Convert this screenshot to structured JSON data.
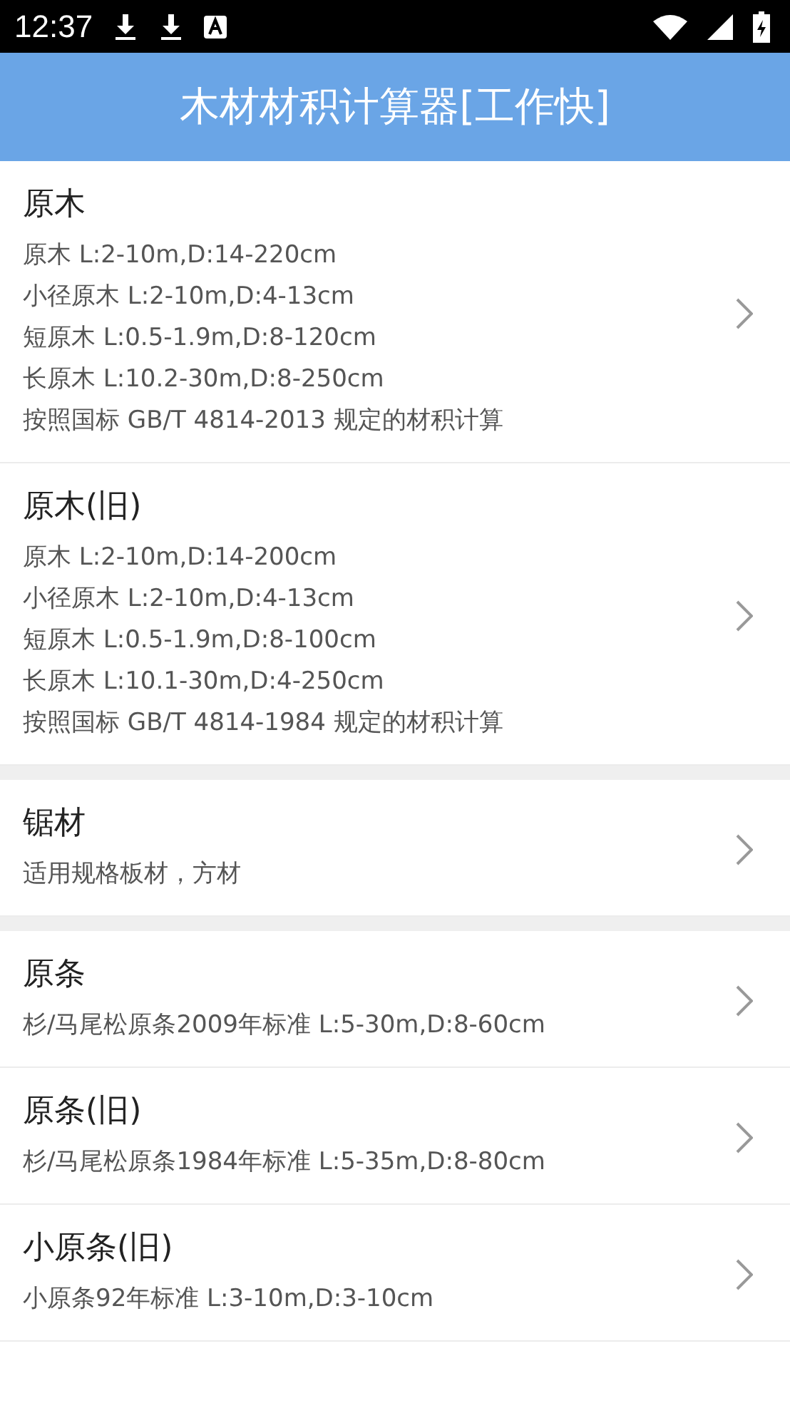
{
  "status_bar": {
    "time": "12:37"
  },
  "app_bar": {
    "title": "木材材积计算器[工作快]"
  },
  "sections": [
    {
      "items": [
        {
          "title": "原木",
          "lines": [
            "原木 L:2-10m,D:14-220cm",
            "小径原木 L:2-10m,D:4-13cm",
            "短原木 L:0.5-1.9m,D:8-120cm",
            "长原木 L:10.2-30m,D:8-250cm",
            "按照国标 GB/T 4814-2013 规定的材积计算"
          ]
        },
        {
          "title": "原木(旧)",
          "lines": [
            "原木 L:2-10m,D:14-200cm",
            "小径原木 L:2-10m,D:4-13cm",
            "短原木 L:0.5-1.9m,D:8-100cm",
            "长原木 L:10.1-30m,D:4-250cm",
            "按照国标 GB/T 4814-1984 规定的材积计算"
          ]
        }
      ]
    },
    {
      "items": [
        {
          "title": "锯材",
          "lines": [
            "适用规格板材，方材"
          ]
        }
      ]
    },
    {
      "items": [
        {
          "title": "原条",
          "lines": [
            "杉/马尾松原条2009年标准 L:5-30m,D:8-60cm"
          ]
        },
        {
          "title": "原条(旧)",
          "lines": [
            "杉/马尾松原条1984年标准 L:5-35m,D:8-80cm"
          ]
        },
        {
          "title": "小原条(旧)",
          "lines": [
            "小原条92年标准 L:3-10m,D:3-10cm"
          ]
        }
      ]
    }
  ]
}
